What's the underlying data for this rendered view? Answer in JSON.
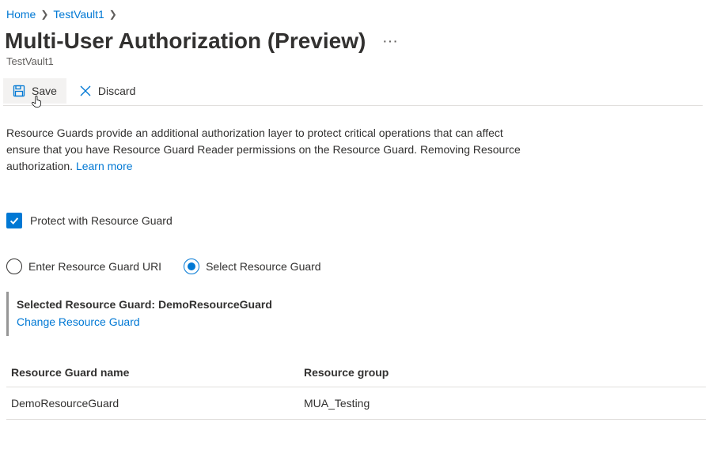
{
  "breadcrumb": {
    "home": "Home",
    "vault": "TestVault1"
  },
  "header": {
    "title": "Multi-User Authorization (Preview)",
    "subtitle": "TestVault1"
  },
  "toolbar": {
    "save": "Save",
    "discard": "Discard"
  },
  "body": {
    "line1": "Resource Guards provide an additional authorization layer to protect critical operations that can affect",
    "line2": "ensure that you have Resource Guard Reader permissions on the Resource Guard. Removing Resource",
    "line3_prefix": "authorization. ",
    "learn_more": "Learn more"
  },
  "protect_checkbox": {
    "label": "Protect with Resource Guard",
    "checked": true
  },
  "radio": {
    "enter_uri": "Enter Resource Guard URI",
    "select_rg": "Select Resource Guard",
    "selected": "select_rg"
  },
  "selected_guard": {
    "label_prefix": "Selected Resource Guard: ",
    "name": "DemoResourceGuard",
    "change_link": "Change Resource Guard"
  },
  "table": {
    "col1_header": "Resource Guard name",
    "col2_header": "Resource group",
    "rows": [
      {
        "name": "DemoResourceGuard",
        "group": "MUA_Testing"
      }
    ]
  }
}
